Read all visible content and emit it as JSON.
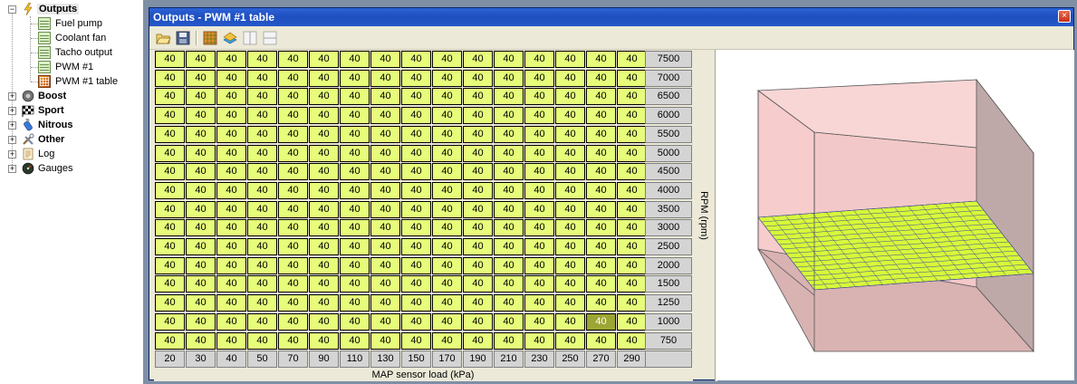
{
  "tree": {
    "outputs": {
      "label": "Outputs",
      "children": [
        "Fuel pump",
        "Coolant fan",
        "Tacho output",
        "PWM #1",
        "PWM #1 table"
      ]
    },
    "sections": [
      {
        "label": "Boost",
        "bold": true
      },
      {
        "label": "Sport",
        "bold": true
      },
      {
        "label": "Nitrous",
        "bold": true
      },
      {
        "label": "Other",
        "bold": true
      },
      {
        "label": "Log",
        "bold": false
      },
      {
        "label": "Gauges",
        "bold": false
      }
    ]
  },
  "window": {
    "title": "Outputs - PWM #1 table",
    "close_symbol": "×"
  },
  "toolbar": {
    "buttons": [
      "open-icon",
      "save-icon",
      "table-view-icon",
      "3d-view-icon",
      "split-vertical-icon",
      "split-horizontal-icon"
    ]
  },
  "table": {
    "rpm_values": [
      "7500",
      "7000",
      "6500",
      "6000",
      "5500",
      "5000",
      "4500",
      "4000",
      "3500",
      "3000",
      "2500",
      "2000",
      "1500",
      "1250",
      "1000",
      "750"
    ],
    "map_values": [
      "20",
      "30",
      "40",
      "50",
      "70",
      "90",
      "110",
      "130",
      "150",
      "170",
      "190",
      "210",
      "230",
      "250",
      "270",
      "290"
    ],
    "cell_value": "40",
    "highlighted_cell": {
      "row": 14,
      "col": 14
    },
    "x_axis_label": "MAP sensor load (kPa)",
    "y_axis_label": "RPM (rpm)"
  },
  "colors": {
    "cell": "#e6fc7a",
    "cell_highlight": "#9ba633",
    "surface": "#d8f83a",
    "box_faces": "#f6cccc",
    "box_bottom": "#d9b2b2"
  }
}
